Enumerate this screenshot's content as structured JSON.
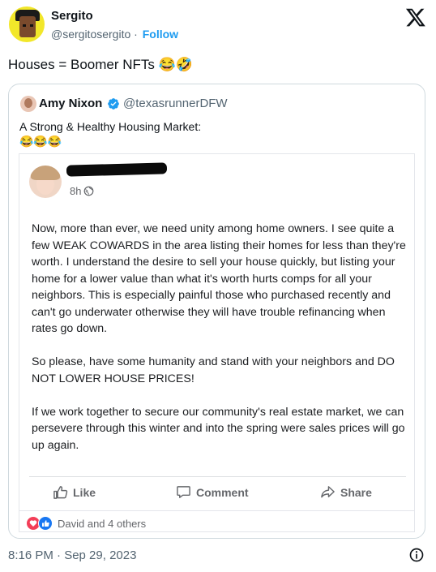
{
  "tweet": {
    "author_name": "Sergito",
    "author_handle": "@sergitosergito",
    "separator": " · ",
    "follow_label": "Follow",
    "text": "Houses = Boomer NFTs 😂🤣",
    "timestamp": "8:16 PM · Sep 29, 2023"
  },
  "quote": {
    "author_name": "Amy Nixon",
    "author_handle": "@texasrunnerDFW",
    "text": "A Strong & Healthy Housing Market:",
    "emoji": "😂😂😂"
  },
  "fb_post": {
    "time": "8h ·",
    "paragraphs": [
      "Now, more than ever, we need unity among home owners. I see quite a few WEAK COWARDS in the area listing their homes for less than they're worth. I understand the desire to sell your house quickly, but listing your home for a lower value than what it's worth hurts comps for all your neighbors. This is especially painful those who purchased recently and can't go underwater otherwise they will have trouble refinancing when rates go down.",
      "So please, have some humanity and stand with your neighbors and DO NOT LOWER HOUSE PRICES!",
      "If we work together to secure our community's real estate market, we can persevere through this winter and into the spring were sales prices will go up again."
    ],
    "actions": {
      "like": "Like",
      "comment": "Comment",
      "share": "Share"
    },
    "reactions_text": "David and 4 others"
  },
  "colors": {
    "twitter_blue": "#1d9bf0",
    "fb_gray": "#65676b",
    "heart_red": "#f33e58",
    "fb_blue": "#1877f2"
  },
  "icons": [
    "x-logo-icon",
    "verified-badge-icon",
    "globe-icon",
    "like-icon",
    "comment-icon",
    "share-icon",
    "heart-reaction-icon",
    "like-reaction-icon",
    "info-icon"
  ]
}
